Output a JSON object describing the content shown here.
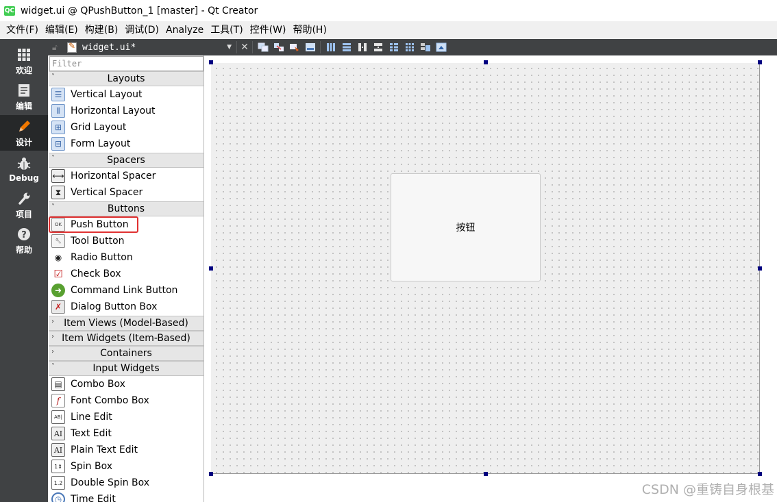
{
  "window": {
    "app_icon": "QC",
    "title": "widget.ui @ QPushButton_1 [master] - Qt Creator"
  },
  "menubar": {
    "items": [
      "文件(F)",
      "编辑(E)",
      "构建(B)",
      "调试(D)",
      "Analyze",
      "工具(T)",
      "控件(W)",
      "帮助(H)"
    ]
  },
  "modebar": {
    "items": [
      {
        "label": "欢迎",
        "icon": "grid-icon"
      },
      {
        "label": "编辑",
        "icon": "document-icon"
      },
      {
        "label": "设计",
        "icon": "pencil-icon",
        "active": true
      },
      {
        "label": "Debug",
        "icon": "bug-icon"
      },
      {
        "label": "项目",
        "icon": "wrench-icon"
      },
      {
        "label": "帮助",
        "icon": "help-icon"
      }
    ]
  },
  "editor_toolbar": {
    "document_name": "widget.ui*"
  },
  "widgetbox": {
    "filter_placeholder": "Filter",
    "categories": {
      "layouts": "Layouts",
      "spacers": "Spacers",
      "buttons": "Buttons",
      "item_views": "Item Views (Model-Based)",
      "item_widgets": "Item Widgets (Item-Based)",
      "containers": "Containers",
      "input_widgets": "Input Widgets"
    },
    "layouts": [
      "Vertical Layout",
      "Horizontal Layout",
      "Grid Layout",
      "Form Layout"
    ],
    "spacers": [
      "Horizontal Spacer",
      "Vertical Spacer"
    ],
    "buttons": [
      "Push Button",
      "Tool Button",
      "Radio Button",
      "Check Box",
      "Command Link Button",
      "Dialog Button Box"
    ],
    "input_widgets": [
      "Combo Box",
      "Font Combo Box",
      "Line Edit",
      "Text Edit",
      "Plain Text Edit",
      "Spin Box",
      "Double Spin Box",
      "Time Edit"
    ],
    "selected_item": "Push Button"
  },
  "form": {
    "button_text": "按钮"
  },
  "watermark": "CSDN @重铸自身根基"
}
